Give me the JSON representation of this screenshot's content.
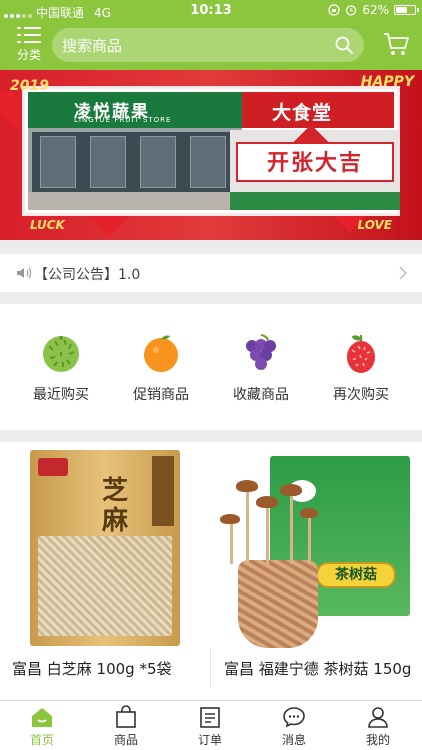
{
  "status_bar": {
    "carrier": "中国联通",
    "network": "4G",
    "time": "10:13",
    "battery": "62%",
    "battery_level": 0.62
  },
  "header": {
    "category_label": "分类",
    "search_placeholder": "搜索商品",
    "accent_color": "#8cc63f"
  },
  "banner": {
    "store_name": "凌悦蔬果",
    "store_name_en": "LINGYUE FRUIT STORE",
    "sign_right": "大食堂",
    "opening_text": "开张大吉",
    "year_text": "2019",
    "happy_text": "HAPPY",
    "luck_text": "LUCK",
    "love_text": "LOVE"
  },
  "announcement": {
    "text": "【公司公告】1.0"
  },
  "quick_entries": [
    {
      "label": "最近购买",
      "icon": "durian-icon"
    },
    {
      "label": "促销商品",
      "icon": "orange-icon"
    },
    {
      "label": "收藏商品",
      "icon": "grape-icon"
    },
    {
      "label": "再次购买",
      "icon": "lychee-icon"
    }
  ],
  "products": [
    {
      "name": "富昌 白芝麻 100g *5袋",
      "package_title": "芝麻"
    },
    {
      "name": "富昌 福建宁德 茶树菇 150g",
      "package_title": "茶树菇"
    }
  ],
  "tabbar": [
    {
      "label": "首页",
      "icon": "home-icon",
      "active": true
    },
    {
      "label": "商品",
      "icon": "bag-icon",
      "active": false
    },
    {
      "label": "订单",
      "icon": "order-icon",
      "active": false
    },
    {
      "label": "消息",
      "icon": "message-icon",
      "active": false
    },
    {
      "label": "我的",
      "icon": "profile-icon",
      "active": false
    }
  ]
}
